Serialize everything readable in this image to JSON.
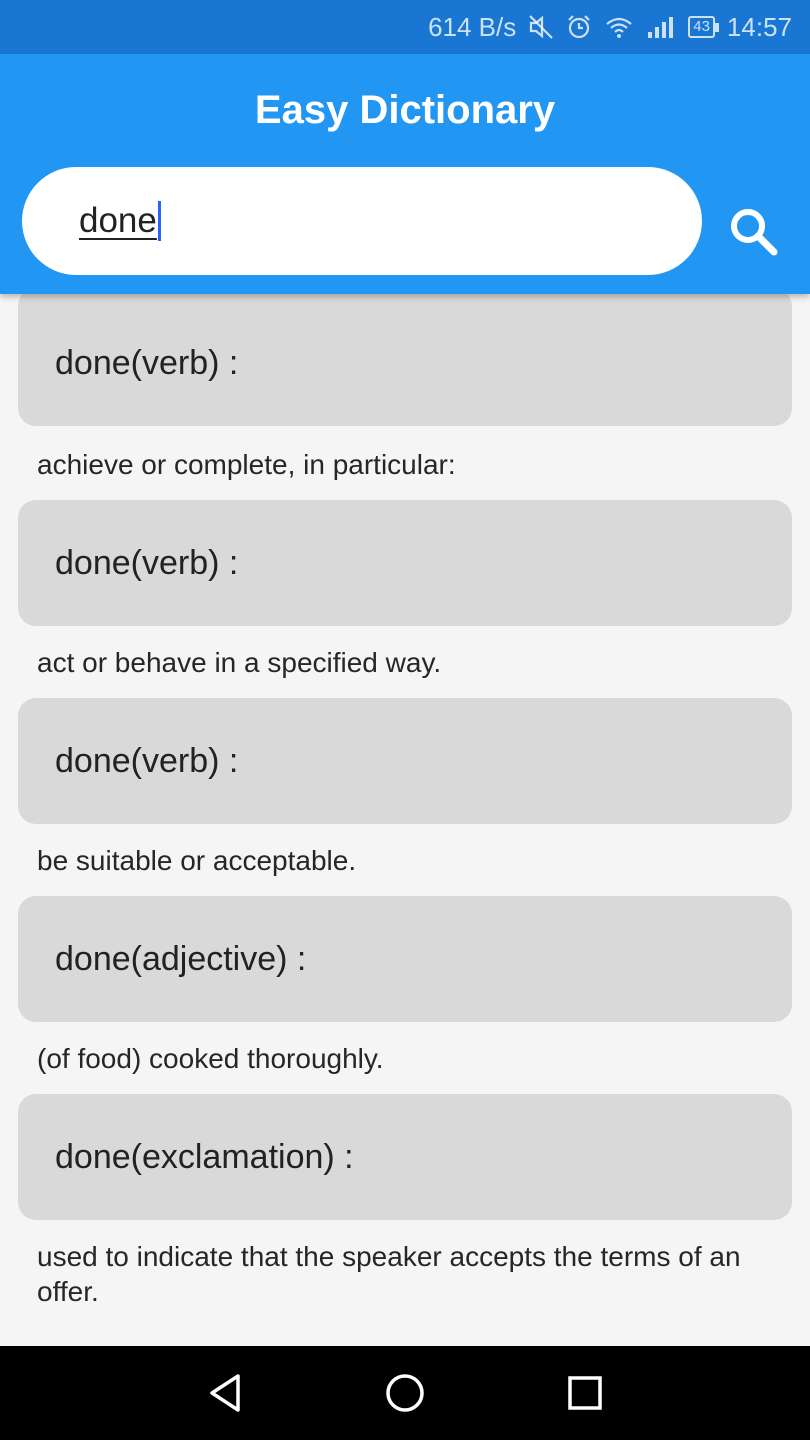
{
  "status_bar": {
    "network_speed": "614 B/s",
    "battery": "43",
    "time": "14:57",
    "icons": [
      "mute-icon",
      "alarm-icon",
      "wifi-icon",
      "signal-icon",
      "battery-icon"
    ]
  },
  "app_bar": {
    "title": "Easy Dictionary",
    "color": "#2196f3"
  },
  "search": {
    "value": "done",
    "button_icon": "search-icon"
  },
  "results": [
    {
      "heading": "done(verb) :",
      "definition": "achieve or complete, in particular:"
    },
    {
      "heading": "done(verb) :",
      "definition": "act or behave in a specified way."
    },
    {
      "heading": "done(verb) :",
      "definition": "be suitable or acceptable."
    },
    {
      "heading": "done(adjective) :",
      "definition": "(of food) cooked thoroughly."
    },
    {
      "heading": "done(exclamation) :",
      "definition": "used to indicate that the speaker accepts the terms of an offer."
    }
  ],
  "nav_bar": {
    "buttons": [
      "back-icon",
      "home-icon",
      "recents-icon"
    ]
  }
}
